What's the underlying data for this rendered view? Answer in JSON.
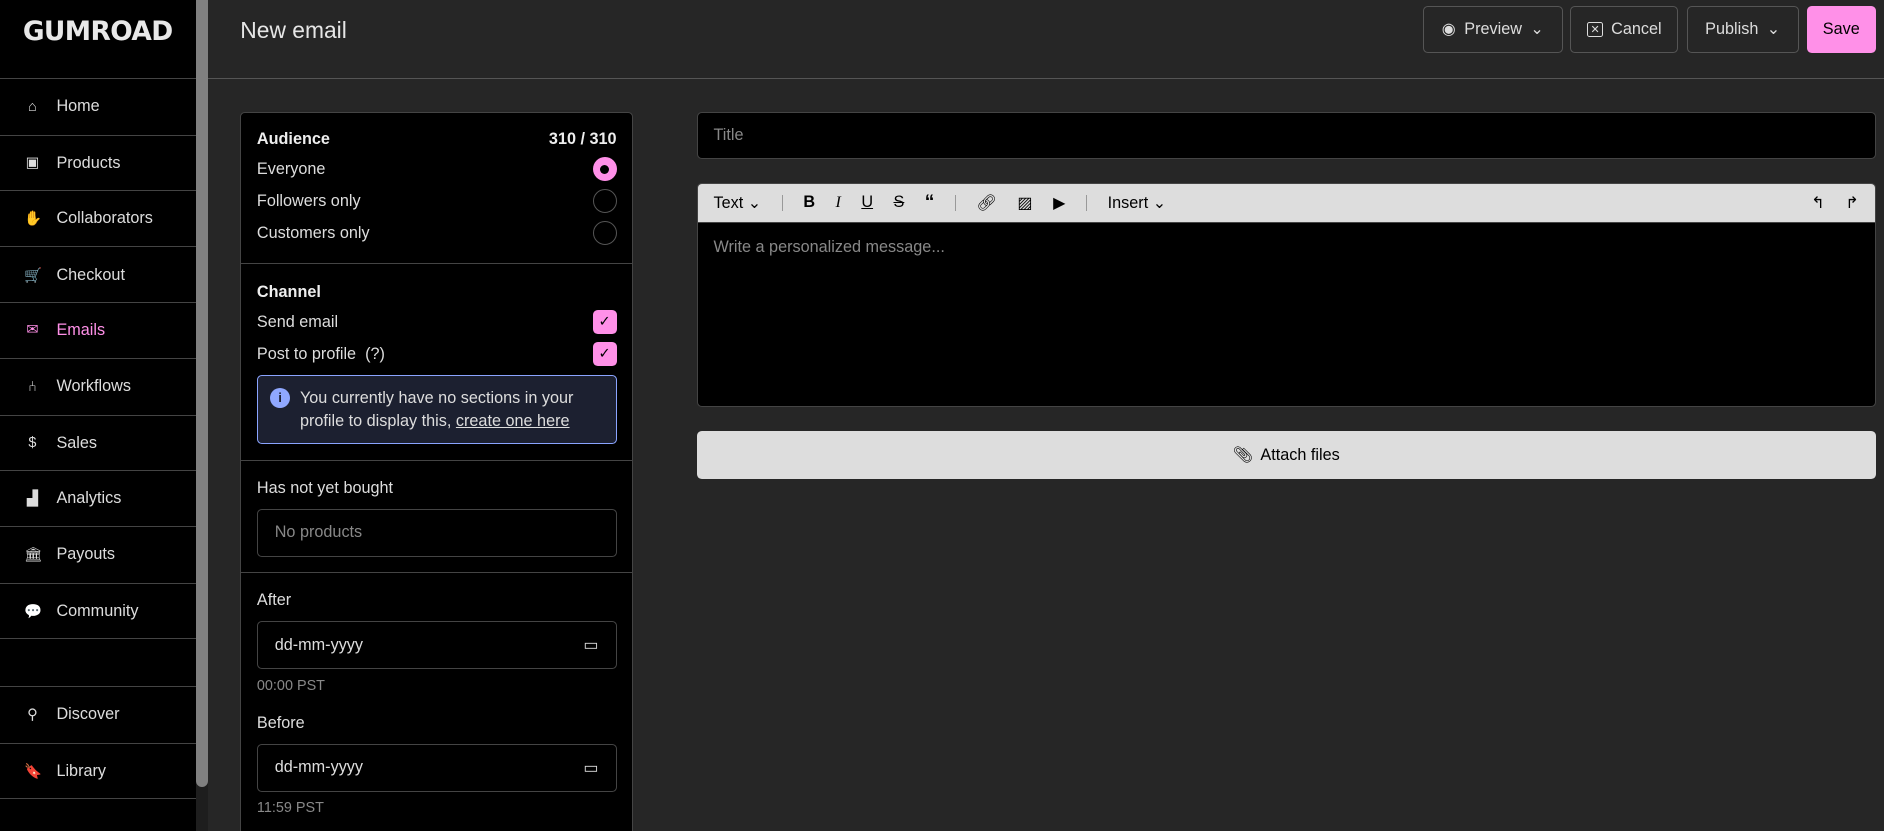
{
  "brand": "GUMROAD",
  "nav": [
    {
      "label": "Home",
      "icon": "store-icon",
      "glyph": "⌂"
    },
    {
      "label": "Products",
      "icon": "archive-icon",
      "glyph": "▣"
    },
    {
      "label": "Collaborators",
      "icon": "handshake-icon",
      "glyph": "✋"
    },
    {
      "label": "Checkout",
      "icon": "cart-icon",
      "glyph": "🛒"
    },
    {
      "label": "Emails",
      "icon": "envelope-icon",
      "glyph": "✉"
    },
    {
      "label": "Workflows",
      "icon": "workflow-icon",
      "glyph": "⑃"
    },
    {
      "label": "Sales",
      "icon": "dollar-icon",
      "glyph": "$"
    },
    {
      "label": "Analytics",
      "icon": "bar-chart-icon",
      "glyph": "▟"
    },
    {
      "label": "Payouts",
      "icon": "bank-icon",
      "glyph": "🏛"
    },
    {
      "label": "Community",
      "icon": "chat-icon",
      "glyph": "💬"
    },
    {
      "label": "Discover",
      "icon": "search-icon",
      "glyph": "⚲"
    },
    {
      "label": "Library",
      "icon": "bookmark-icon",
      "glyph": "🔖"
    }
  ],
  "header": {
    "title": "New email",
    "preview": "Preview",
    "cancel": "Cancel",
    "publish": "Publish",
    "save": "Save"
  },
  "audience": {
    "title": "Audience",
    "count": "310 / 310",
    "options": [
      "Everyone",
      "Followers only",
      "Customers only"
    ],
    "selected": 0
  },
  "channel": {
    "title": "Channel",
    "send_email": "Send email",
    "post_to_profile": "Post to profile",
    "help": "(?)",
    "info_text": "You currently have no sections in your profile to display this,",
    "info_link": "create one here"
  },
  "filters": {
    "not_bought_label": "Has not yet bought",
    "not_bought_placeholder": "No products",
    "after_label": "After",
    "after_value": "dd-mm-yyyy",
    "after_time": "00:00 PST",
    "before_label": "Before",
    "before_value": "dd-mm-yyyy",
    "before_time": "11:59 PST"
  },
  "editor": {
    "title_placeholder": "Title",
    "text_menu": "Text",
    "insert_menu": "Insert",
    "message_placeholder": "Write a personalized message...",
    "attach": "Attach files"
  },
  "colors": {
    "accent": "#ff90e8",
    "info": "#90a8ff"
  }
}
